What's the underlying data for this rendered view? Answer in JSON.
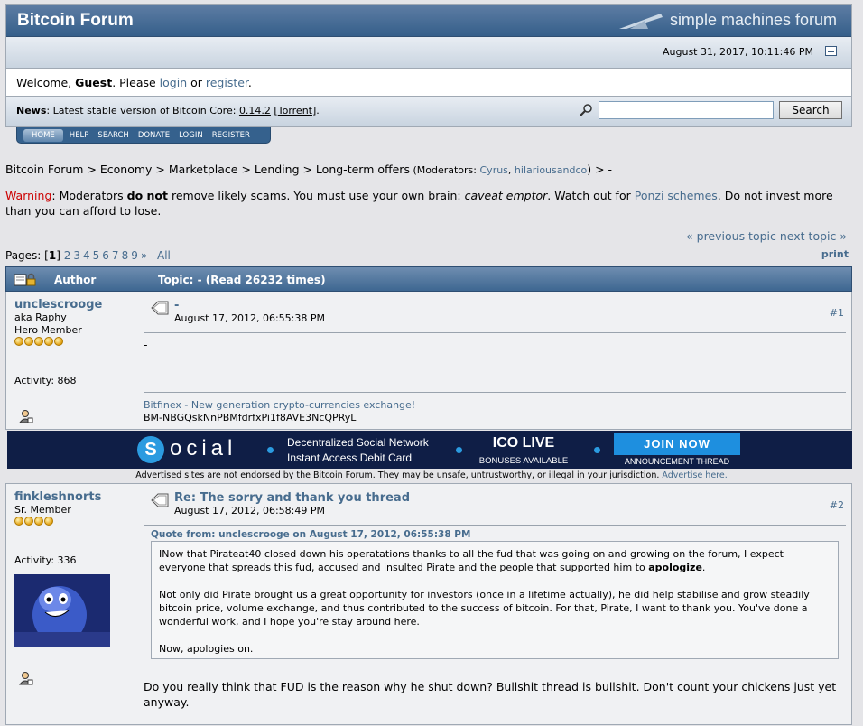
{
  "header": {
    "forum_title": "Bitcoin Forum",
    "smf_logo_text": "simple machines forum",
    "datetime": "August 31, 2017, 10:11:46 PM"
  },
  "welcome": {
    "prefix": "Welcome, ",
    "guest": "Guest",
    "middle": ". Please ",
    "login": "login",
    "or": " or ",
    "register": "register",
    "suffix": "."
  },
  "news": {
    "label": "News",
    "text": ": Latest stable version of Bitcoin Core: ",
    "version": "0.14.2",
    "torrent_open": " [",
    "torrent": "Torrent",
    "torrent_close": "]."
  },
  "search": {
    "button_label": "Search",
    "placeholder": ""
  },
  "menu": [
    "HOME",
    "HELP",
    "SEARCH",
    "DONATE",
    "LOGIN",
    "REGISTER"
  ],
  "breadcrumb": {
    "path": "Bitcoin Forum > Economy > Marketplace > Lending > Long-term offers",
    "mods_prefix": " (Moderators: ",
    "mod1": "Cyrus",
    "mod_sep": ", ",
    "mod2": "hilariousandco",
    "mods_suffix": ") > -"
  },
  "warning": {
    "label": "Warning",
    "t1": ": Moderators ",
    "bold": "do not",
    "t2": " remove likely scams. You must use your own brain: ",
    "ital": "caveat emptor",
    "t3": ". Watch out for ",
    "link": "Ponzi schemes",
    "t4": ". Do not invest more than you can afford to lose."
  },
  "nav": {
    "prev": "« previous topic",
    "next": "next topic »",
    "print": "print"
  },
  "pages": {
    "label": "Pages: [",
    "current": "1",
    "close": "]",
    "others": [
      "2",
      "3",
      "4",
      "5",
      "6",
      "7",
      "8",
      "9",
      "»",
      "All"
    ]
  },
  "table_header": {
    "author": "Author",
    "topic": "Topic: -  (Read 26232 times)"
  },
  "posts": [
    {
      "username": "unclescrooge",
      "aka": "aka Raphy",
      "rank": "Hero Member",
      "stars": 5,
      "activity": "Activity: 868",
      "subject": "-",
      "date": "August 17, 2012, 06:55:38 PM",
      "number": "#1",
      "body": "-",
      "sig_link": "Bitfinex - New generation crypto-currencies exchange!",
      "sig_code": "BM-NBGQskNnPBMfdrfxPi1f8AVE3NcQPRyL"
    },
    {
      "username": "finkleshnorts",
      "rank": "Sr. Member",
      "stars": 4,
      "activity": "Activity: 336",
      "subject": "Re: The sorry and thank you thread",
      "date": "August 17, 2012, 06:58:49 PM",
      "number": "#2",
      "quote_header": "Quote from: unclescrooge on August 17, 2012, 06:55:38 PM",
      "quote_p1a": "INow that Pirateat40 closed down his operatations thanks to all the fud that was going on and growing on the forum, I expect everyone that spreads this fud, accused and insulted Pirate and the people that supported him to ",
      "quote_p1b": "apologize",
      "quote_p1c": ".",
      "quote_p2": "Not only did Pirate brought us a great opportunity for investors (once in a lifetime actually), he did help stabilise and grow steadily bitcoin price, volume exchange, and thus contributed to the success of bitcoin. For that, Pirate, I want to thank you. You've done a wonderful work, and I hope you're stay around here.",
      "quote_p3": "Now, apologies on.",
      "body": "Do you really think that FUD is the reason why he shut down? Bullshit thread is bullshit. Don't count your chickens just yet anyway."
    }
  ],
  "ad": {
    "logo_letter": "S",
    "brand": "ocial",
    "line1": "Decentralized Social Network",
    "line2": "Instant Access Debit Card",
    "ico": "ICO LIVE",
    "bonuses": "BONUSES AVAILABLE",
    "join": "JOIN NOW",
    "announce": "ANNOUNCEMENT THREAD",
    "note": "Advertised sites are not endorsed by the Bitcoin Forum. They may be unsafe, untrustworthy, or illegal in your jurisdiction. ",
    "note_link": "Advertise here."
  }
}
